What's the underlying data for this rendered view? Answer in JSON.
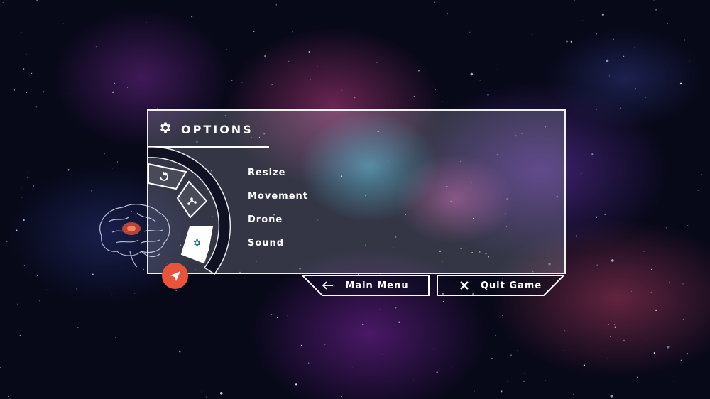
{
  "panel": {
    "title": "OPTIONS",
    "title_icon": "gear-icon"
  },
  "menu": {
    "items": [
      {
        "label": "Resize"
      },
      {
        "label": "Movement"
      },
      {
        "label": "Drone"
      },
      {
        "label": "Sound"
      }
    ]
  },
  "dial": {
    "segments": [
      {
        "icon": "rotate-icon",
        "active": false
      },
      {
        "icon": "path-icon",
        "active": false
      },
      {
        "icon": "gear-icon",
        "active": true
      }
    ]
  },
  "buttons": {
    "main_menu": {
      "label": "Main Menu",
      "icon": "arrow-left-icon"
    },
    "quit_game": {
      "label": "Quit Game",
      "icon": "close-icon"
    }
  },
  "navigation": {
    "icon": "navigation-arrow-icon"
  },
  "brain": {
    "icon": "brain-icon"
  },
  "colors": {
    "accent": "#e8533a",
    "frame": "#ffffff",
    "active_segment_icon": "#1d6f86"
  }
}
